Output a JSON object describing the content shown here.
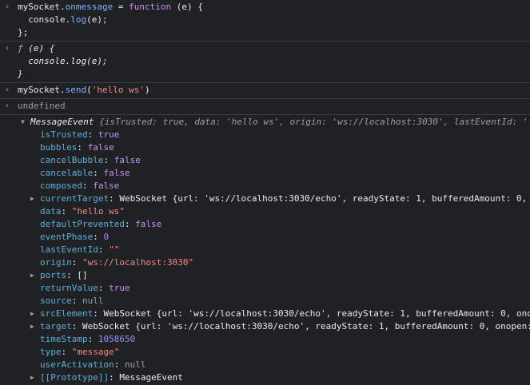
{
  "entries": [
    {
      "type": "input",
      "lines": [
        [
          "mySocket.",
          "onmessage",
          " = ",
          "function",
          " (e) {"
        ],
        [
          "  console.",
          "log",
          "(e);"
        ],
        [
          "};"
        ]
      ]
    },
    {
      "type": "output",
      "lines": [
        [
          "ƒ",
          " (e) {"
        ],
        [
          "  console.log(e);"
        ],
        [
          "}"
        ]
      ]
    },
    {
      "type": "input",
      "lines": [
        [
          "mySocket.",
          "send",
          "(",
          "'hello ws'",
          ")"
        ]
      ]
    },
    {
      "type": "output",
      "lines": [
        [
          "undefined"
        ]
      ]
    }
  ],
  "event": {
    "header": {
      "name": "MessageEvent",
      "preview": " {isTrusted: true, data: 'hello ws', origin: 'ws://localhost:3030', lastEventId: ''"
    },
    "properties": [
      {
        "key": "isTrusted",
        "val": "true",
        "kind": "bool",
        "expand": false
      },
      {
        "key": "bubbles",
        "val": "false",
        "kind": "bool",
        "expand": false
      },
      {
        "key": "cancelBubble",
        "val": "false",
        "kind": "bool",
        "expand": false
      },
      {
        "key": "cancelable",
        "val": "false",
        "kind": "bool",
        "expand": false
      },
      {
        "key": "composed",
        "val": "false",
        "kind": "bool",
        "expand": false
      },
      {
        "key": "currentTarget",
        "val": "WebSocket {url: 'ws://localhost:3030/echo', readyState: 1, bufferedAmount: 0,",
        "kind": "obj",
        "expand": true
      },
      {
        "key": "data",
        "val": "\"hello ws\"",
        "kind": "str",
        "expand": false
      },
      {
        "key": "defaultPrevented",
        "val": "false",
        "kind": "bool",
        "expand": false
      },
      {
        "key": "eventPhase",
        "val": "0",
        "kind": "num",
        "expand": false
      },
      {
        "key": "lastEventId",
        "val": "\"\"",
        "kind": "str",
        "expand": false
      },
      {
        "key": "origin",
        "val": "\"ws://localhost:3030\"",
        "kind": "str",
        "expand": false
      },
      {
        "key": "ports",
        "val": "[]",
        "kind": "obj",
        "expand": true
      },
      {
        "key": "returnValue",
        "val": "true",
        "kind": "bool",
        "expand": false
      },
      {
        "key": "source",
        "val": "null",
        "kind": "null",
        "expand": false
      },
      {
        "key": "srcElement",
        "val": "WebSocket {url: 'ws://localhost:3030/echo', readyState: 1, bufferedAmount: 0, ono",
        "kind": "obj",
        "expand": true
      },
      {
        "key": "target",
        "val": "WebSocket {url: 'ws://localhost:3030/echo', readyState: 1, bufferedAmount: 0, onopen:",
        "kind": "obj",
        "expand": true
      },
      {
        "key": "timeStamp",
        "val": "1058650",
        "kind": "num",
        "expand": false
      },
      {
        "key": "type",
        "val": "\"message\"",
        "kind": "str",
        "expand": false
      },
      {
        "key": "userActivation",
        "val": "null",
        "kind": "null",
        "expand": false
      },
      {
        "key": "[[Prototype]]",
        "val": "MessageEvent",
        "kind": "obj",
        "expand": true
      }
    ]
  }
}
